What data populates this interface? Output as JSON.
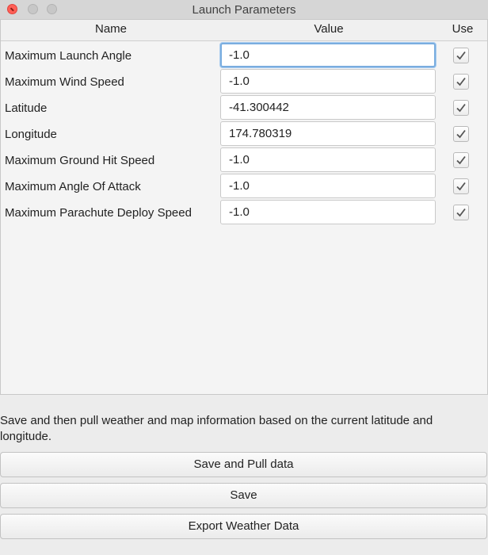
{
  "window": {
    "title": "Launch Parameters"
  },
  "table": {
    "headers": {
      "name": "Name",
      "value": "Value",
      "use": "Use"
    },
    "rows": [
      {
        "name": "Maximum Launch Angle",
        "value": "-1.0",
        "use": true
      },
      {
        "name": "Maximum Wind Speed",
        "value": "-1.0",
        "use": true
      },
      {
        "name": "Latitude",
        "value": "-41.300442",
        "use": true
      },
      {
        "name": "Longitude",
        "value": "174.780319",
        "use": true
      },
      {
        "name": "Maximum Ground Hit Speed",
        "value": "-1.0",
        "use": true
      },
      {
        "name": "Maximum Angle Of Attack",
        "value": "-1.0",
        "use": true
      },
      {
        "name": "Maximum Parachute Deploy Speed",
        "value": "-1.0",
        "use": true
      }
    ]
  },
  "info_text": "Save and then pull weather and map information based on the current latitude and longitude.",
  "buttons": {
    "save_pull": "Save and Pull data",
    "save": "Save",
    "export": "Export Weather Data"
  },
  "colors": {
    "focus_ring": "#7aaddf",
    "close_button": "#ff5f56"
  }
}
